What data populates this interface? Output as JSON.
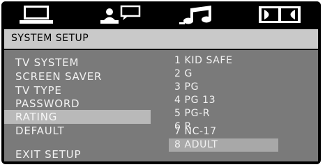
{
  "icons": [
    {
      "name": "monitor-icon"
    },
    {
      "name": "person-speech-icon"
    },
    {
      "name": "music-note-icon"
    },
    {
      "name": "dolby-logo-icon"
    }
  ],
  "header": {
    "title": "SYSTEM SETUP"
  },
  "menu": {
    "items": [
      {
        "label": "TV SYSTEM"
      },
      {
        "label": "SCREEN SAVER"
      },
      {
        "label": "TV TYPE"
      },
      {
        "label": "PASSWORD"
      },
      {
        "label": "RATING"
      },
      {
        "label": "DEFAULT"
      }
    ],
    "selected": "RATING",
    "exit_label": "EXIT SETUP"
  },
  "rating_options": {
    "items": [
      {
        "label": "1 KID SAFE"
      },
      {
        "label": "2 G"
      },
      {
        "label": "3 PG"
      },
      {
        "label": "4 PG 13"
      },
      {
        "label": "5 PG-R"
      },
      {
        "label": "6 R"
      },
      {
        "label": "7 NC-17"
      },
      {
        "label": "8 ADULT"
      }
    ],
    "selected": "8 ADULT"
  },
  "colors": {
    "panel": "#7a7a7a",
    "header": "#c9c9c9",
    "highlight": "#b9b9b9",
    "frame": "#000000"
  }
}
